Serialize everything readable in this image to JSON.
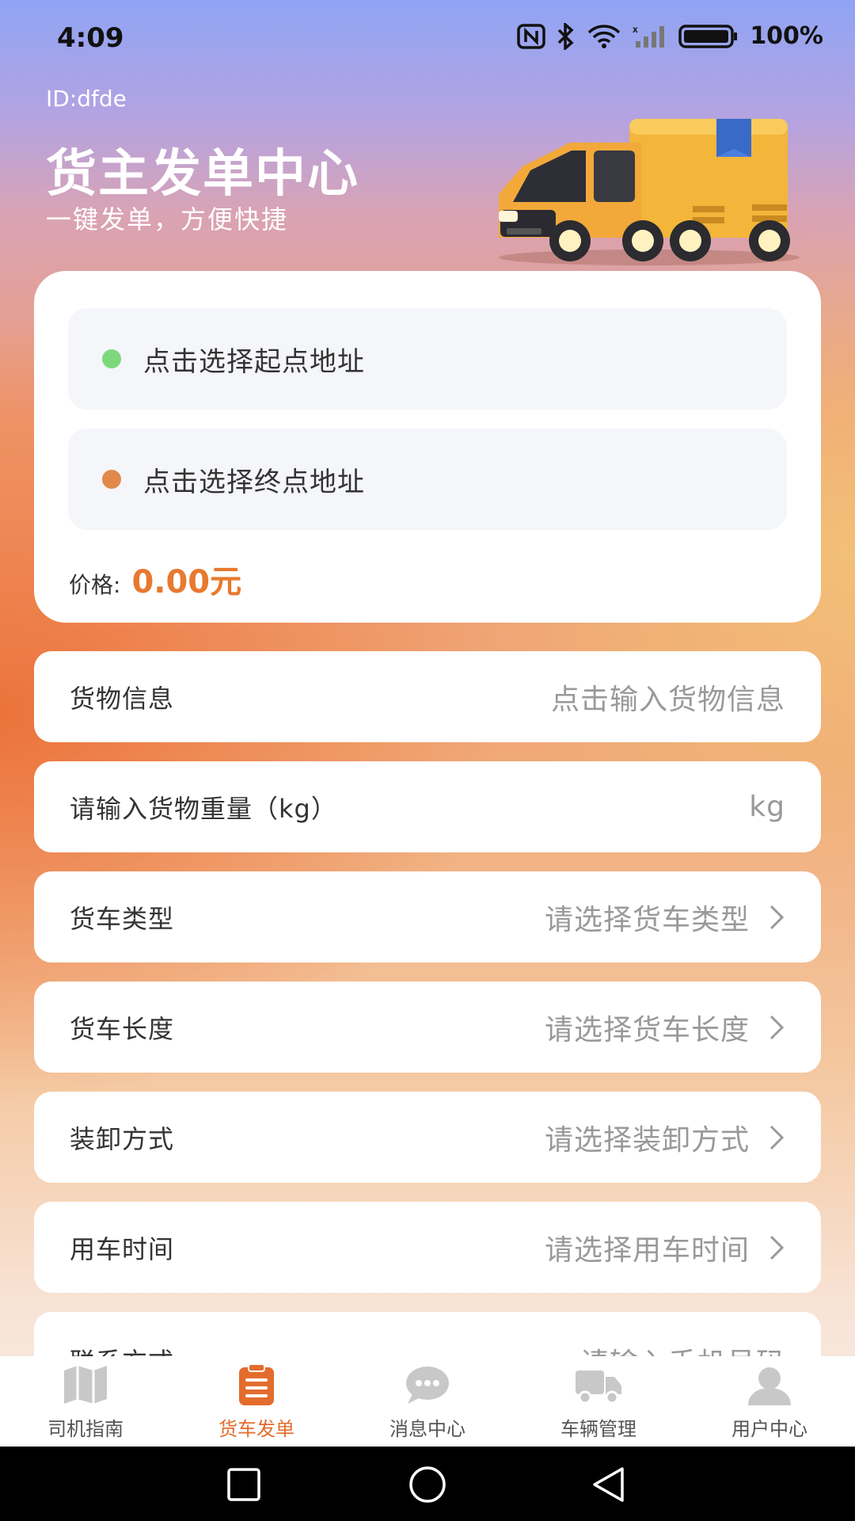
{
  "status_bar": {
    "time": "4:09",
    "battery": "100%"
  },
  "header": {
    "id_label": "ID:dfde",
    "title": "货主发单中心",
    "subtitle": "一键发单，方便快捷",
    "illustration": "truck-illustration"
  },
  "route": {
    "start_placeholder": "点击选择起点地址",
    "end_placeholder": "点击选择终点地址",
    "start_dot_color": "#7dd87c",
    "end_dot_color": "#e0894a",
    "price_label": "价格:",
    "price_value": "0.00元"
  },
  "form": {
    "goods_info": {
      "label": "货物信息",
      "placeholder": "点击输入货物信息"
    },
    "weight": {
      "label": "请输入货物重量（kg）",
      "placeholder": "kg"
    },
    "truck_type": {
      "label": "货车类型",
      "placeholder": "请选择货车类型"
    },
    "truck_length": {
      "label": "货车长度",
      "placeholder": "请选择货车长度"
    },
    "loading_method": {
      "label": "装卸方式",
      "placeholder": "请选择装卸方式"
    },
    "use_time": {
      "label": "用车时间",
      "placeholder": "请选择用车时间"
    },
    "contact": {
      "label": "联系方式",
      "placeholder": "请输入手机号码"
    }
  },
  "tab_bar": {
    "active_color": "#e36c2c",
    "items": [
      {
        "label": "司机指南",
        "icon": "map-icon"
      },
      {
        "label": "货车发单",
        "icon": "clipboard-icon"
      },
      {
        "label": "消息中心",
        "icon": "chat-icon"
      },
      {
        "label": "车辆管理",
        "icon": "truck-icon"
      },
      {
        "label": "用户中心",
        "icon": "user-icon"
      }
    ]
  }
}
